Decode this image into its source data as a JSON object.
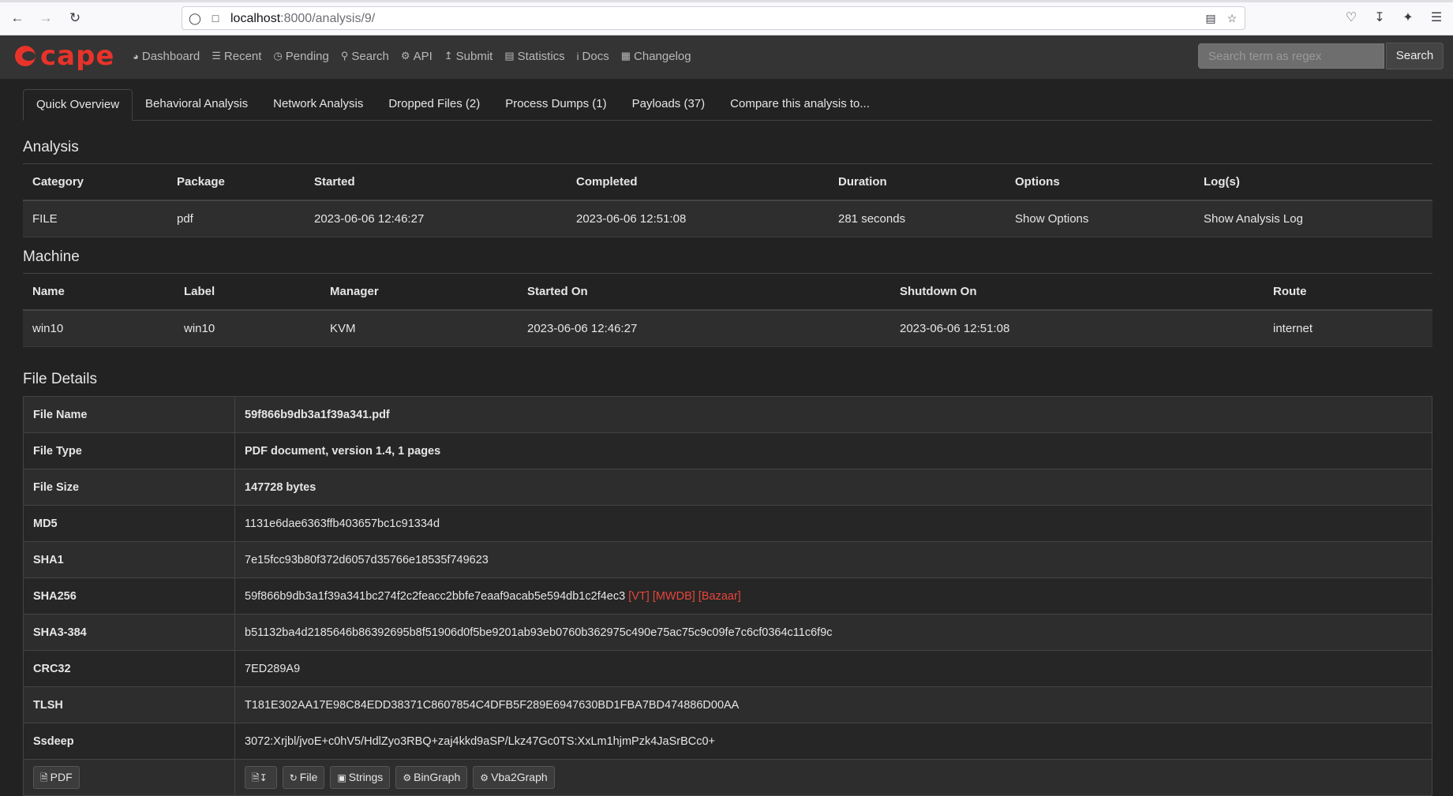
{
  "browser": {
    "url_host": "localhost",
    "url_rest": ":8000/analysis/9/"
  },
  "nav": {
    "logo_text": "cape",
    "items": [
      {
        "label": "Dashboard",
        "icon": "dashboard-icon"
      },
      {
        "label": "Recent",
        "icon": "list-icon"
      },
      {
        "label": "Pending",
        "icon": "clock-icon"
      },
      {
        "label": "Search",
        "icon": "search-icon"
      },
      {
        "label": "API",
        "icon": "gears-icon"
      },
      {
        "label": "Submit",
        "icon": "upload-icon"
      },
      {
        "label": "Statistics",
        "icon": "chart-icon"
      },
      {
        "label": "Docs",
        "icon": "info-icon"
      },
      {
        "label": "Changelog",
        "icon": "calendar-icon"
      }
    ],
    "search_placeholder": "Search term as regex",
    "search_button": "Search"
  },
  "tabs": [
    "Quick Overview",
    "Behavioral Analysis",
    "Network Analysis",
    "Dropped Files (2)",
    "Process Dumps (1)",
    "Payloads (37)",
    "Compare this analysis to..."
  ],
  "analysis": {
    "title": "Analysis",
    "headers": [
      "Category",
      "Package",
      "Started",
      "Completed",
      "Duration",
      "Options",
      "Log(s)"
    ],
    "row": [
      "FILE",
      "pdf",
      "2023-06-06 12:46:27",
      "2023-06-06 12:51:08",
      "281 seconds",
      "Show Options",
      "Show Analysis Log"
    ]
  },
  "machine": {
    "title": "Machine",
    "headers": [
      "Name",
      "Label",
      "Manager",
      "Started On",
      "Shutdown On",
      "Route"
    ],
    "row": [
      "win10",
      "win10",
      "KVM",
      "2023-06-06 12:46:27",
      "2023-06-06 12:51:08",
      "internet"
    ]
  },
  "file_details": {
    "title": "File Details",
    "rows": [
      {
        "key": "File Name",
        "value": "59f866b9db3a1f39a341.pdf"
      },
      {
        "key": "File Type",
        "value": "PDF document, version 1.4, 1 pages"
      },
      {
        "key": "File Size",
        "value": "147728 bytes"
      },
      {
        "key": "MD5",
        "value": "1131e6dae6363ffb403657bc1c91334d"
      },
      {
        "key": "SHA1",
        "value": "7e15fcc93b80f372d6057d35766e18535f749623"
      },
      {
        "key": "SHA256",
        "value": "59f866b9db3a1f39a341bc274f2c2feacc2bbfe7eaaf9acab5e594db1c2f4ec3",
        "links": [
          "[VT]",
          "[MWDB]",
          "[Bazaar]"
        ]
      },
      {
        "key": "SHA3-384",
        "value": "b51132ba4d2185646b86392695b8f51906d0f5be9201ab93eb0760b362975c490e75ac75c9c09fe7c6cf0364c11c6f9c"
      },
      {
        "key": "CRC32",
        "value": "7ED289A9"
      },
      {
        "key": "TLSH",
        "value": "T181E302AA17E98C84EDD38371C8607854C4DFB5F289E6947630BD1FBA7BD474886D00AA"
      },
      {
        "key": "Ssdeep",
        "value": "3072:Xrjbl/jvoE+c0hV5/HdlZyo3RBQ+zaj4kkd9aSP/Lkz47Gc0TS:XxLm1hjmPzk4JaSrBCc0+"
      }
    ],
    "action_left": "PDF",
    "actions": [
      "File",
      "Strings",
      "BinGraph",
      "Vba2Graph"
    ]
  }
}
